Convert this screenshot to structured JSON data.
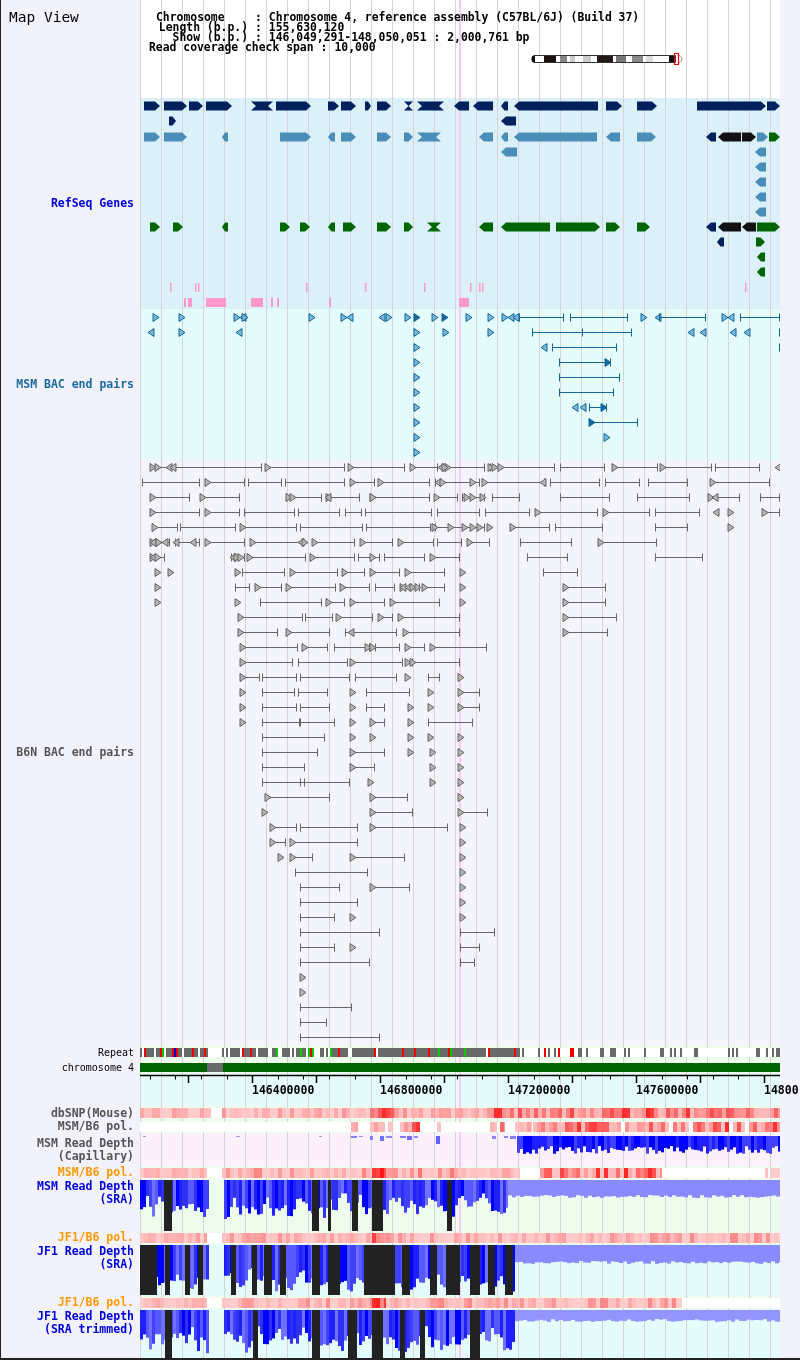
{
  "panel": {
    "title": "Map View"
  },
  "header": {
    "rows": [
      {
        "key": "Chromosome",
        "sep": ":",
        "value": "Chromosome 4, reference assembly (C57BL/6J) (Build 37)"
      },
      {
        "key": "Length (b.p.)",
        "sep": ":",
        "value": "155,630,120"
      },
      {
        "key": "Show (b.p.)",
        "sep": ":",
        "value": "146,049,291-148,050,051 : 2,000,761 bp"
      }
    ],
    "coverage": {
      "key": "Read coverage check span",
      "sep": ":",
      "value": "10,000"
    }
  },
  "tracks": [
    {
      "kind": "genes",
      "label": "RefSeq Genes",
      "color": "#0000dd"
    },
    {
      "kind": "bacpairs",
      "label": "MSM BAC end pairs",
      "color": "#1a6aa0"
    },
    {
      "kind": "bacpairs",
      "label": "B6N BAC end pairs",
      "color": "#555555"
    },
    {
      "kind": "repeat",
      "label": "Repeat"
    },
    {
      "kind": "chromosome",
      "label": "chromosome 4"
    },
    {
      "kind": "axis",
      "ticks": [
        "146400000",
        "146800000",
        "147200000",
        "147600000",
        "14800"
      ]
    },
    {
      "kind": "heatmap",
      "label": "dbSNP(Mouse)",
      "color": "#555555"
    },
    {
      "kind": "heatmap",
      "label": "MSM/B6 pol.",
      "color": "#555555"
    },
    {
      "kind": "depth",
      "label": "MSM Read Depth (Capillary)",
      "color": "#555555"
    },
    {
      "kind": "heatmap",
      "label": "MSM/B6 pol.",
      "color": "#ff9900"
    },
    {
      "kind": "depth",
      "label": "MSM Read Depth (SRA)",
      "color": "#0000dd"
    },
    {
      "kind": "heatmap",
      "label": "JF1/B6 pol.",
      "color": "#ff9900"
    },
    {
      "kind": "depth",
      "label": "JF1 Read Depth (SRA)",
      "color": "#0000dd"
    },
    {
      "kind": "heatmap",
      "label": "JF1/B6 pol.",
      "color": "#ff9900"
    },
    {
      "kind": "depth",
      "label": "JF1 Read Depth (SRA trimmed)",
      "color": "#0000dd"
    }
  ]
}
